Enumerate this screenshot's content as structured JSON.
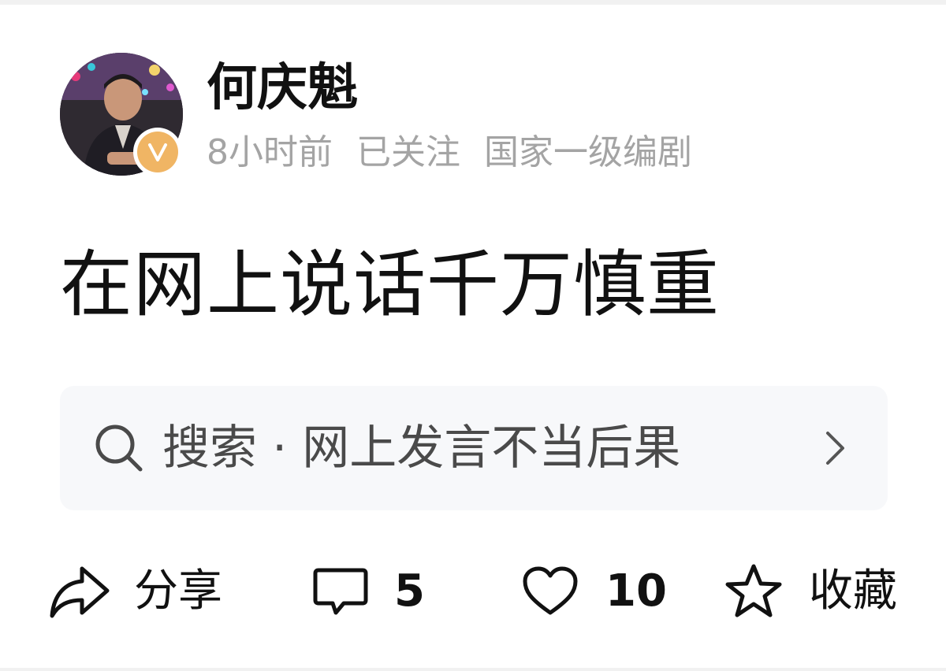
{
  "post": {
    "author": {
      "name": "何庆魁",
      "verified_badge_letter": "V",
      "time_ago": "8小时前",
      "follow_status": "已关注",
      "title": "国家一级编剧"
    },
    "text": "在网上说话千万慎重"
  },
  "search_suggestion": {
    "text": "搜索 · 网上发言不当后果",
    "icon": "search-icon",
    "arrow_icon": "chevron-right-icon"
  },
  "actions": {
    "share": {
      "label": "分享",
      "icon": "share-icon"
    },
    "comment": {
      "count": "5",
      "icon": "comment-icon"
    },
    "like": {
      "count": "10",
      "icon": "heart-icon"
    },
    "favorite": {
      "label": "收藏",
      "icon": "star-icon"
    }
  },
  "colors": {
    "text_primary": "#111111",
    "text_secondary": "#a4a4a4",
    "search_background": "#f7f8fa",
    "verified_badge": "#f0b564"
  }
}
